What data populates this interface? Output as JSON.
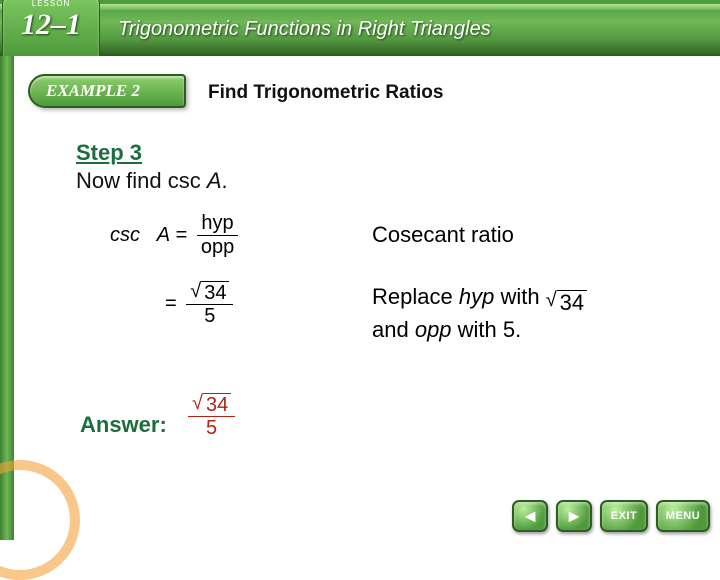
{
  "lesson": {
    "tag": "LESSON",
    "number": "12–1"
  },
  "banner_title": "Trigonometric Functions in Right Triangles",
  "example": {
    "label": "EXAMPLE 2",
    "subtitle": "Find Trigonometric Ratios"
  },
  "step": {
    "label": "Step 3",
    "pre": "Now find csc ",
    "var": "A",
    "post": "."
  },
  "eq1": {
    "lhs_func": "csc",
    "lhs_var": "A",
    "eq": " = ",
    "num": "hyp",
    "den": "opp"
  },
  "eq2": {
    "eq": "= ",
    "num_under_root": "34",
    "den": "5"
  },
  "explain1": "Cosecant ratio",
  "explain2": {
    "pre": "Replace ",
    "hyp": "hyp",
    "mid": " with ",
    "root": "34",
    "post1": "and ",
    "opp": "opp",
    "post2": " with 5."
  },
  "answer": {
    "label": "Answer:",
    "num_under_root": "34",
    "den": "5"
  },
  "nav": {
    "prev": "◄",
    "next": "►",
    "exit": "EXIT",
    "menu": "MENU"
  }
}
